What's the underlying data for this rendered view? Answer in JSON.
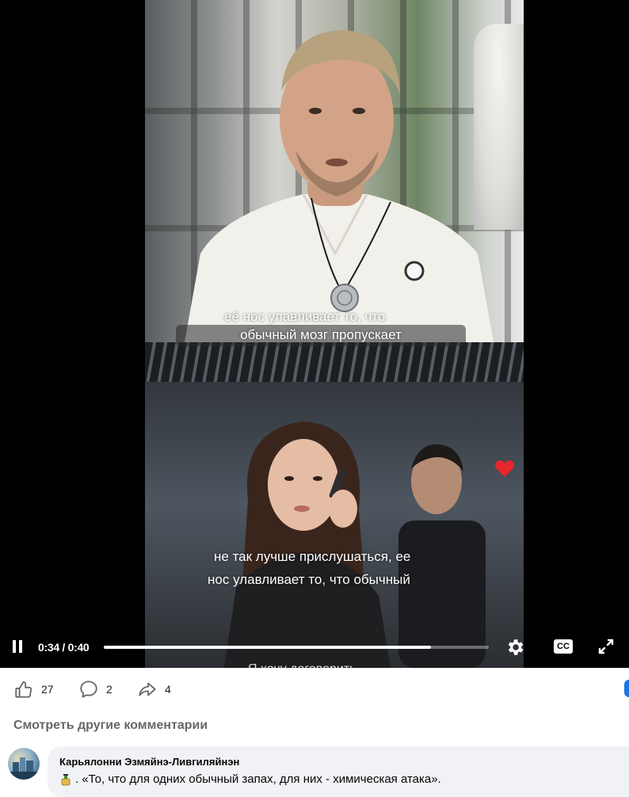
{
  "video": {
    "subtitle_top": [
      "её нос улавливает то, что",
      "обычный мозг пропускает"
    ],
    "subtitle_bottom": [
      "не так лучше прислушаться, ее",
      "нос улавливает то, что обычный"
    ],
    "watermark_cutoff": "Я хочу договорить",
    "controls": {
      "time": "0:34 / 0:40",
      "progress": 0.85,
      "cc_label": "CC"
    }
  },
  "reactions": {
    "likes": "27",
    "comments": "2",
    "shares": "4"
  },
  "comments": {
    "more_label": "Смотреть другие комментарии",
    "items": [
      {
        "author": "Карьялонни Эзмяйнэ-Ливгиляйнэн",
        "text": ". «То, что для одних обычный запах, для них - химическая атака»."
      }
    ]
  },
  "colors": {
    "accent": "#1b74e4",
    "secondary_text": "#65676b",
    "bubble_bg": "#f0f2f5"
  }
}
